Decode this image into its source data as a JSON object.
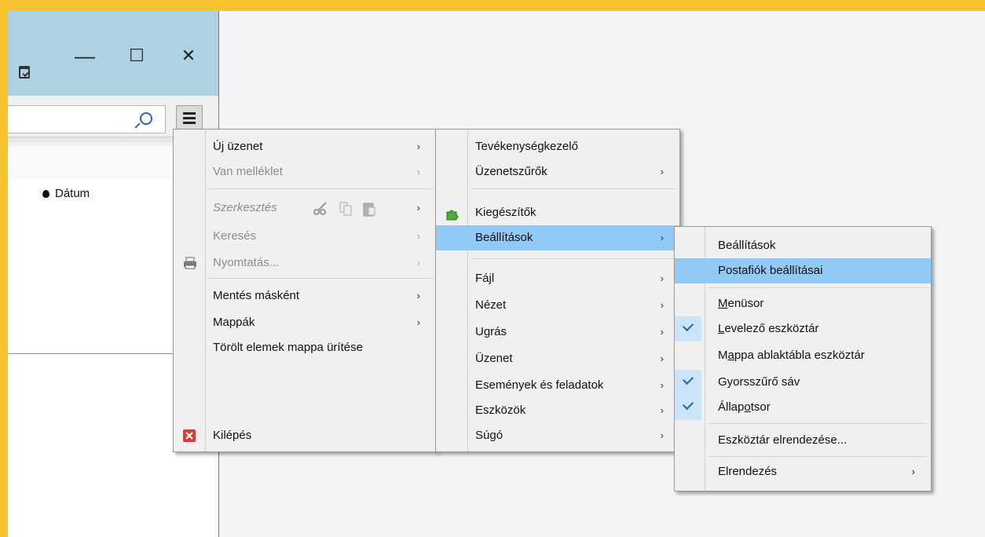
{
  "window": {
    "minimize": "—",
    "maximize": "☐",
    "close": "✕",
    "column_date": "Dátum"
  },
  "main_menu": {
    "items": [
      {
        "label": "Új üzenet",
        "arrow": "›"
      },
      {
        "label": "Van melléklet",
        "arrow": "›"
      },
      {
        "label": "Szerkesztés",
        "arrow": "›"
      },
      {
        "label": "Keresés",
        "arrow": "›"
      },
      {
        "label": "Nyomtatás...",
        "arrow": "›"
      },
      {
        "label": "Mentés másként",
        "arrow": "›"
      },
      {
        "label": "Mappák",
        "arrow": "›"
      },
      {
        "label": "Törölt elemek mappa ürítése"
      },
      {
        "label": "Kilépés"
      }
    ]
  },
  "second_menu": {
    "items": [
      {
        "label": "Tevékenységkezelő"
      },
      {
        "label": "Üzenetszűrők",
        "arrow": "›"
      },
      {
        "label": "Kiegészítők"
      },
      {
        "label": "Beállítások",
        "arrow": "›"
      },
      {
        "label": "Fájl",
        "arrow": "›"
      },
      {
        "label": "Nézet",
        "arrow": "›"
      },
      {
        "label": "Ugrás",
        "arrow": "›"
      },
      {
        "label": "Üzenet",
        "arrow": "›"
      },
      {
        "label": "Események és feladatok",
        "arrow": "›"
      },
      {
        "label": "Eszközök",
        "arrow": "›"
      },
      {
        "label": "Súgó",
        "arrow": "›"
      }
    ]
  },
  "settings_menu": {
    "items": [
      {
        "label": "Beállítások"
      },
      {
        "label": "Postafiók beállításai"
      },
      {
        "label_pre": "",
        "label_u": "M",
        "label_post": "enüsor"
      },
      {
        "label_pre": "",
        "label_u": "L",
        "label_post": "evelező eszköztár"
      },
      {
        "label_pre": "M",
        "label_u": "a",
        "label_post": "ppa ablaktábla eszköztár"
      },
      {
        "label": "Gyorsszűrő sáv"
      },
      {
        "label_pre": "Állap",
        "label_u": "o",
        "label_post": "tsor"
      },
      {
        "label": "Eszköztár elrendezése..."
      },
      {
        "label": "Elrendezés",
        "arrow": "›"
      }
    ]
  }
}
